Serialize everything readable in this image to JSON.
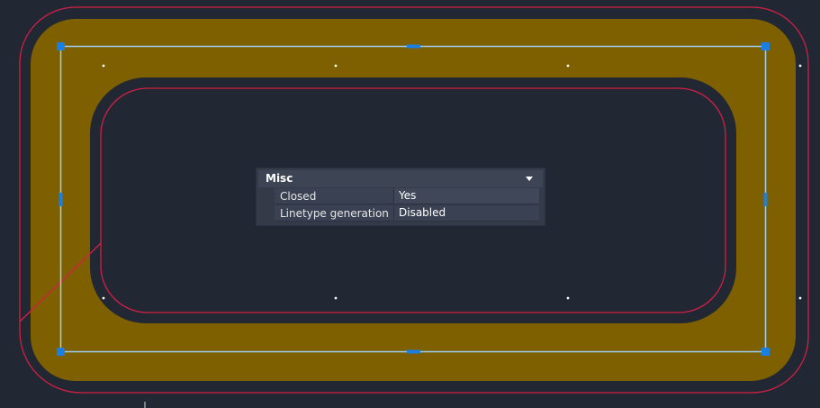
{
  "colors": {
    "background": "#222833",
    "copper_fill": "#7f6000",
    "outline": "#d21f46",
    "selection_edge": "#9ccdf5",
    "grip": "#1a7fe0",
    "vertex": "#ffffff"
  },
  "properties_panel": {
    "section_title": "Misc",
    "collapse_icon": "chevron-down-icon",
    "rows": [
      {
        "name": "Closed",
        "value": "Yes"
      },
      {
        "name": "Linetype generation",
        "value": "Disabled"
      }
    ]
  }
}
